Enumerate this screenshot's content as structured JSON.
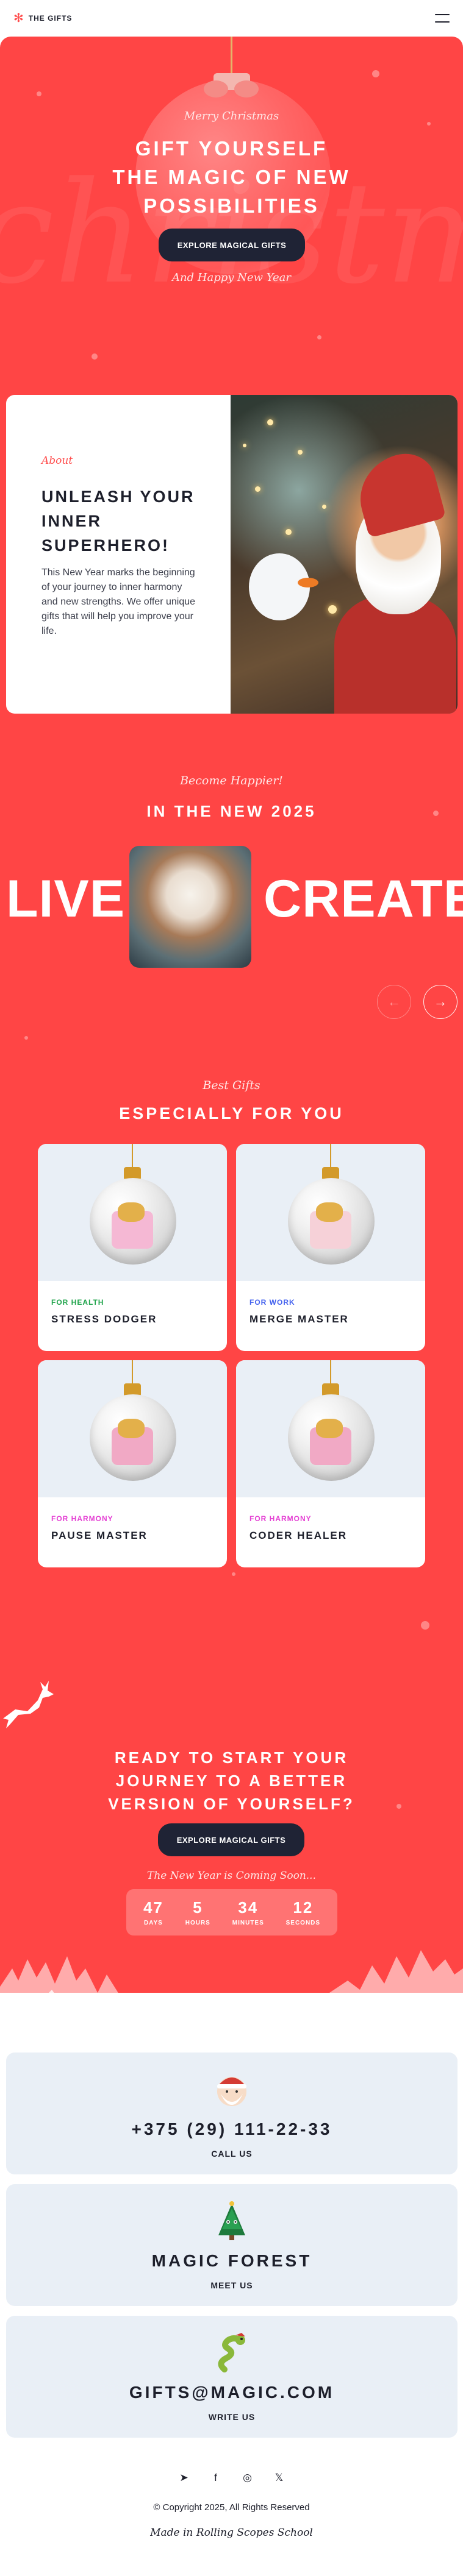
{
  "header": {
    "logo_text": "THE GIFTS",
    "logo_icon": "snowflake-icon",
    "menu_icon": "burger-menu-icon"
  },
  "colors": {
    "accent": "#ff4545",
    "dark": "#1f2335",
    "light_card": "#e9eff6",
    "tag_health": "#1ea34a",
    "tag_work": "#4361ee",
    "tag_harmony": "#e43fd3"
  },
  "hero": {
    "script_top": "Merry Christmas",
    "title_line1": "GIFT YOURSELF",
    "title_line2": "THE MAGIC OF NEW",
    "title_line3": "POSSIBILITIES",
    "button": "EXPLORE MAGICAL GIFTS",
    "script_bottom": "And Happy New Year",
    "bg_word": "christmas"
  },
  "about": {
    "kicker": "About",
    "title": "UNLEASH YOUR INNER SUPERHERO!",
    "text": "This New Year marks the beginning of your journey to inner harmony and new strengths. We offer unique gifts that will help you improve your life."
  },
  "slider": {
    "script": "Become Happier!",
    "title": "IN THE NEW 2025",
    "word_left": "LIVE",
    "word_right": "CREATE",
    "prev_icon": "←",
    "next_icon": "→"
  },
  "gifts": {
    "script": "Best Gifts",
    "title": "ESPECIALLY FOR YOU",
    "items": [
      {
        "tag": "FOR HEALTH",
        "title": "STRESS DODGER"
      },
      {
        "tag": "FOR WORK",
        "title": "MERGE MASTER"
      },
      {
        "tag": "FOR HARMONY",
        "title": "PAUSE MASTER"
      },
      {
        "tag": "FOR HARMONY",
        "title": "CODER HEALER"
      }
    ]
  },
  "cta": {
    "title_line1": "READY TO START YOUR",
    "title_line2": "JOURNEY TO A BETTER",
    "title_line3": "VERSION OF YOURSELF?",
    "button": "EXPLORE MAGICAL GIFTS",
    "script": "The New Year is Coming Soon...",
    "timer": [
      {
        "value": "47",
        "label": "DAYS"
      },
      {
        "value": "5",
        "label": "HOURS"
      },
      {
        "value": "34",
        "label": "MINUTES"
      },
      {
        "value": "12",
        "label": "SECONDS"
      }
    ]
  },
  "contacts": [
    {
      "title": "+375 (29) 111-22-33",
      "sub": "CALL US",
      "icon": "santa-icon"
    },
    {
      "title": "MAGIC FOREST",
      "sub": "MEET US",
      "icon": "christmas-tree-icon"
    },
    {
      "title": "GIFTS@MAGIC.COM",
      "sub": "WRITE US",
      "icon": "snake-icon"
    }
  ],
  "footer": {
    "socials": [
      "telegram-icon",
      "facebook-icon",
      "instagram-icon",
      "x-icon"
    ],
    "social_glyphs": [
      "➤",
      "f",
      "◎",
      "𝕏"
    ],
    "copyright": "© Copyright 2025, All Rights Reserved",
    "made_in": "Made in Rolling Scopes School"
  }
}
